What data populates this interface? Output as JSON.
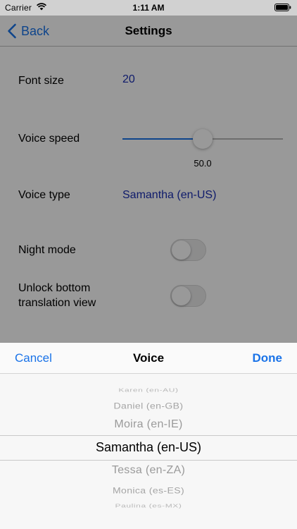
{
  "status_bar": {
    "carrier": "Carrier",
    "time": "1:11 AM"
  },
  "nav": {
    "back_label": "Back",
    "title": "Settings"
  },
  "settings": {
    "font_size": {
      "label": "Font size",
      "value": "20"
    },
    "voice_speed": {
      "label": "Voice speed",
      "value": 50.0,
      "value_text": "50.0",
      "min": 0,
      "max": 100
    },
    "voice_type": {
      "label": "Voice type",
      "value": "Samantha (en-US)"
    },
    "night_mode": {
      "label": "Night mode",
      "on": false
    },
    "unlock_bottom": {
      "label_line1": "Unlock bottom",
      "label_line2": "translation view",
      "on": false
    }
  },
  "picker": {
    "cancel_label": "Cancel",
    "title": "Voice",
    "done_label": "Done",
    "items": [
      "Karen (en-AU)",
      "Daniel (en-GB)",
      "Moira (en-IE)",
      "Samantha (en-US)",
      "Tessa (en-ZA)",
      "Monica (es-ES)",
      "Paulina (es-MX)"
    ],
    "selected": "Samantha (en-US)"
  },
  "colors": {
    "accent": "#1a73e8",
    "value_blue": "#1a2eb3",
    "switch_off": "#e9e9ea"
  },
  "icons": {
    "wifi": "wifi-icon",
    "battery": "battery-icon",
    "back": "chevron-left-icon"
  }
}
